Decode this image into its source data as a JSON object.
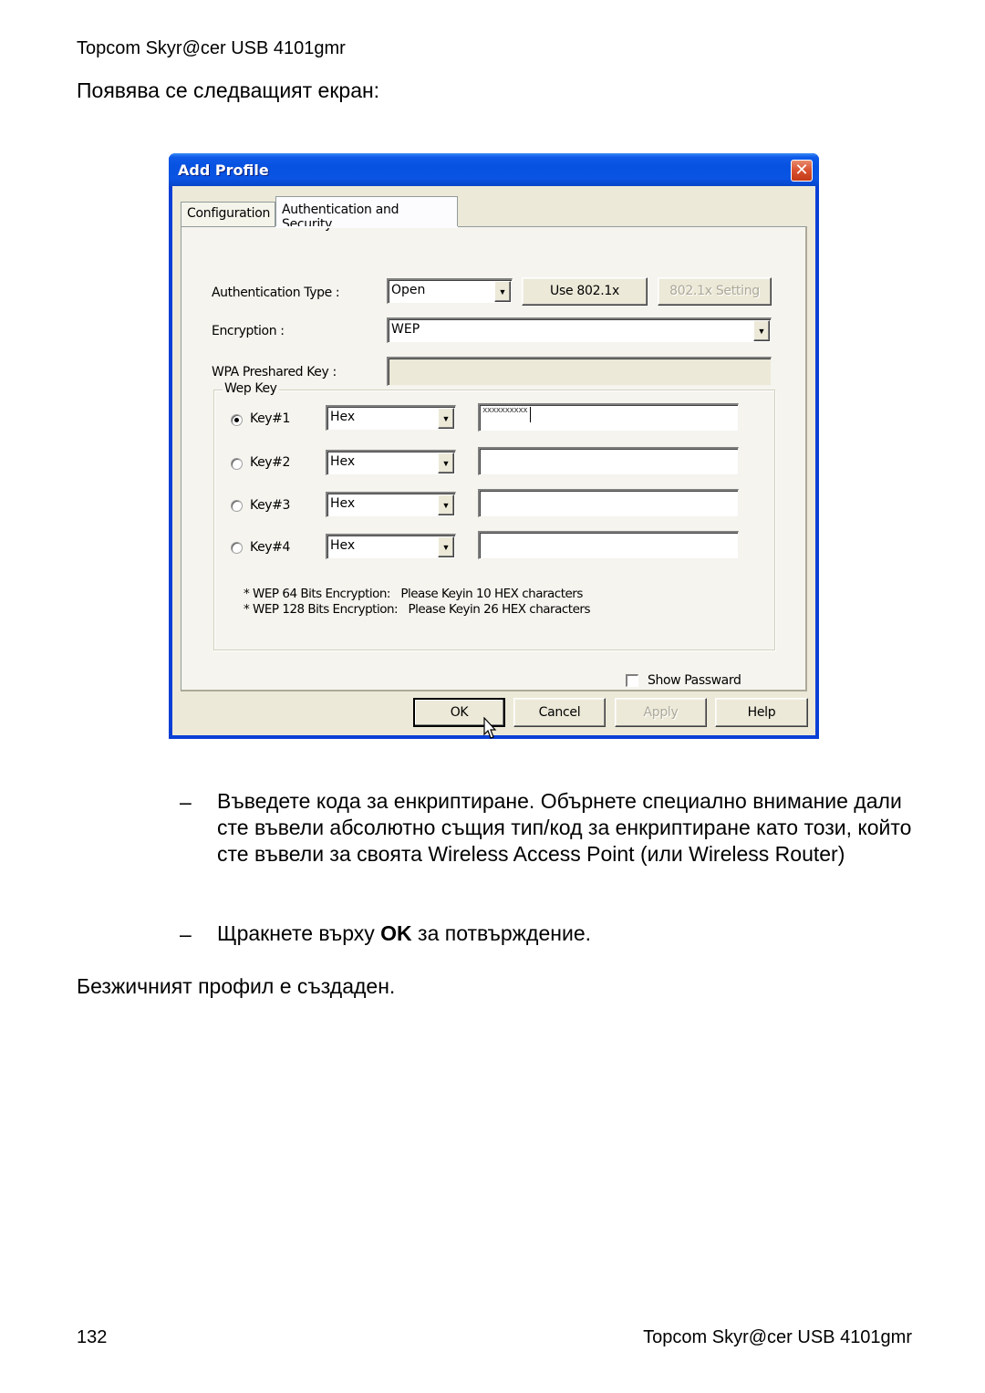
{
  "page": {
    "header": "Topcom Skyr@cer USB 4101gmr",
    "intro": "Появява се следващият екран:",
    "footer_page_number": "132",
    "footer_title": "Topcom Skyr@cer USB 4101gmr"
  },
  "dialog": {
    "title": "Add Profile",
    "close_glyph": "✕",
    "tabs": [
      {
        "label": "Configuration",
        "active": false
      },
      {
        "label": "Authentication and Security",
        "active": true
      }
    ],
    "auth_type": {
      "label": "Authentication Type :",
      "value": "Open",
      "use_8021x_button": "Use 802.1x",
      "setting_8021x_button": "802.1x Setting"
    },
    "encryption": {
      "label": "Encryption :",
      "value": "WEP"
    },
    "wpa_psk": {
      "label": "WPA Preshared Key :",
      "value": ""
    },
    "wep_key_group": {
      "title": "Wep Key",
      "keys": [
        {
          "label": "Key#1",
          "selected": true,
          "format": "Hex",
          "value_masked": "xxxxxxxxxx"
        },
        {
          "label": "Key#2",
          "selected": false,
          "format": "Hex",
          "value_masked": ""
        },
        {
          "label": "Key#3",
          "selected": false,
          "format": "Hex",
          "value_masked": ""
        },
        {
          "label": "Key#4",
          "selected": false,
          "format": "Hex",
          "value_masked": ""
        }
      ],
      "notes": [
        "* WEP 64 Bits Encryption:   Please Keyin 10 HEX characters",
        "* WEP 128 Bits Encryption:   Please Keyin 26 HEX characters"
      ]
    },
    "show_password": {
      "label": "Show Passward",
      "checked": false
    },
    "buttons": {
      "ok": "OK",
      "cancel": "Cancel",
      "apply": "Apply",
      "help": "Help"
    },
    "colors": {
      "titlebar": "#0a54e4",
      "client_bg": "#ece9d8",
      "close_button": "#d9502e"
    }
  },
  "instructions": {
    "bullet1": "Въведете кода за енкриптиране. Обърнете специално внимание дали сте въвели абсолютно същия тип/код за енкриптиране като този, който сте въвели за своята Wireless Access Point  (или Wireless Router)",
    "bullet2_prefix": "Щракнете върху ",
    "bullet2_bold": "OK",
    "bullet2_suffix": " за потвърждение.",
    "dash": "–",
    "conclusion": "Безжичният профил е създаден."
  }
}
